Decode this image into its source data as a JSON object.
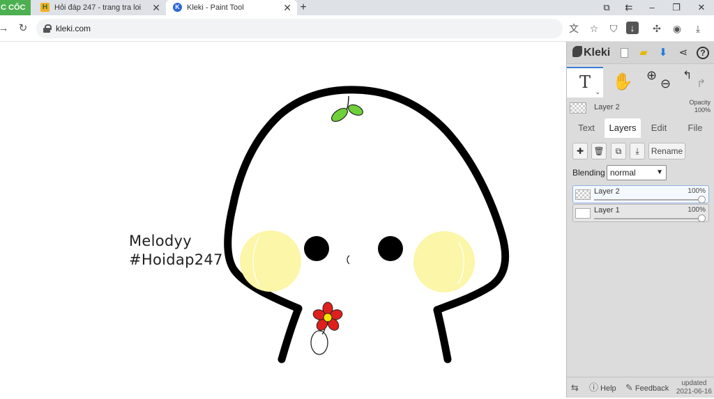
{
  "browser": {
    "brand": "C CỐC",
    "tabs": [
      {
        "favicon": "H",
        "title": "Hỏi đáp 247 - trang tra loi",
        "close": "✕"
      },
      {
        "favicon": "K",
        "title": "Kleki - Paint Tool",
        "close": "✕"
      }
    ],
    "new_tab": "+",
    "window_controls": {
      "minimize": "–",
      "maximize": "❐",
      "close": "✕"
    },
    "url": "kleki.com"
  },
  "canvas": {
    "signature_line1": "Melodyy",
    "signature_line2": "#Hoidap247",
    "colors": {
      "outline": "#000000",
      "blush": "#fbf6a8",
      "sprout": "#6ed13a",
      "flower": "#e0201c",
      "flower_center": "#f5e500"
    }
  },
  "kleki": {
    "logo": "Kleki",
    "current_layer": {
      "name": "Layer 2",
      "opacity_label": "Opacity",
      "opacity_value": "100%"
    },
    "tabs": [
      {
        "label": "Text",
        "active": false
      },
      {
        "label": "Layers",
        "active": true
      },
      {
        "label": "Edit",
        "active": false
      },
      {
        "label": "File",
        "active": false
      }
    ],
    "rename_label": "Rename",
    "blending_label": "Blending",
    "blending_value": "normal",
    "layers": [
      {
        "name": "Layer 2",
        "opacity": "100%",
        "selected": true
      },
      {
        "name": "Layer 1",
        "opacity": "100%",
        "selected": false
      }
    ],
    "footer": {
      "help": "Help",
      "feedback": "Feedback",
      "updated_label": "updated",
      "updated_date": "2021-06-16"
    },
    "accent": "#3a7bd5"
  }
}
